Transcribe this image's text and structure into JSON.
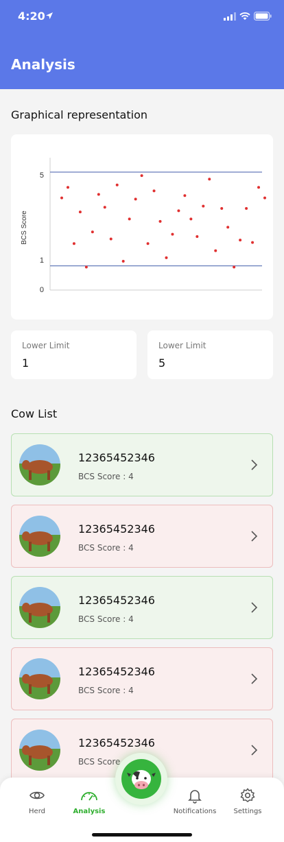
{
  "status_bar": {
    "time": "4:20"
  },
  "header": {
    "title": "Analysis"
  },
  "graph_section": {
    "title": "Graphical representation"
  },
  "chart_data": {
    "type": "scatter",
    "ylabel": "BCS Score",
    "xlabel": "",
    "y_ticks": [
      "5",
      "1",
      "0"
    ],
    "ylim": [
      0,
      5
    ],
    "reference_lines": [
      {
        "value": 5,
        "color": "#3f5aa8"
      },
      {
        "value": 1,
        "color": "#3f5aa8"
      }
    ],
    "grid": false,
    "point_color": "#e03030",
    "points": [
      {
        "x": 1,
        "y": 3.9
      },
      {
        "x": 2,
        "y": 4.35
      },
      {
        "x": 3,
        "y": 1.95
      },
      {
        "x": 4,
        "y": 3.3
      },
      {
        "x": 5,
        "y": 0.95
      },
      {
        "x": 6,
        "y": 2.45
      },
      {
        "x": 7,
        "y": 4.05
      },
      {
        "x": 8,
        "y": 3.5
      },
      {
        "x": 9,
        "y": 2.15
      },
      {
        "x": 10,
        "y": 4.45
      },
      {
        "x": 11,
        "y": 1.2
      },
      {
        "x": 12,
        "y": 3.0
      },
      {
        "x": 13,
        "y": 3.85
      },
      {
        "x": 14,
        "y": 4.85
      },
      {
        "x": 15,
        "y": 1.95
      },
      {
        "x": 16,
        "y": 4.2
      },
      {
        "x": 17,
        "y": 2.9
      },
      {
        "x": 18,
        "y": 1.35
      },
      {
        "x": 19,
        "y": 2.35
      },
      {
        "x": 20,
        "y": 3.35
      },
      {
        "x": 21,
        "y": 4.0
      },
      {
        "x": 22,
        "y": 3.0
      },
      {
        "x": 23,
        "y": 2.25
      },
      {
        "x": 24,
        "y": 3.55
      },
      {
        "x": 25,
        "y": 4.7
      },
      {
        "x": 26,
        "y": 1.65
      },
      {
        "x": 27,
        "y": 3.45
      },
      {
        "x": 28,
        "y": 2.65
      },
      {
        "x": 29,
        "y": 0.95
      },
      {
        "x": 30,
        "y": 2.1
      },
      {
        "x": 31,
        "y": 3.45
      },
      {
        "x": 32,
        "y": 2.0
      },
      {
        "x": 33,
        "y": 4.35
      },
      {
        "x": 34,
        "y": 3.9
      }
    ]
  },
  "limits": {
    "lower": {
      "label": "Lower Limit",
      "value": "1"
    },
    "upper": {
      "label": "Lower Limit",
      "value": "5"
    }
  },
  "cow_list": {
    "title": "Cow List",
    "items": [
      {
        "id": "12365452346",
        "score": "BCS Score : 4",
        "status": "good"
      },
      {
        "id": "12365452346",
        "score": "BCS Score : 4",
        "status": "bad"
      },
      {
        "id": "12365452346",
        "score": "BCS Score : 4",
        "status": "good"
      },
      {
        "id": "12365452346",
        "score": "BCS Score : 4",
        "status": "bad"
      },
      {
        "id": "12365452346",
        "score": "BCS Score : 4",
        "status": "bad"
      }
    ]
  },
  "tabbar": {
    "herd": "Herd",
    "analysis": "Analysis",
    "notifications": "Notifications",
    "settings": "Settings",
    "active_color": "#2eae2e",
    "icons": {
      "herd": "eye-icon",
      "analysis": "gauge-icon",
      "center": "cow-face-icon",
      "notifications": "bell-icon",
      "settings": "gear-icon"
    }
  },
  "colors": {
    "header": "#5b78e8",
    "accent": "#2eae2e",
    "good_card": "#eef6ec",
    "bad_card": "#faeeee"
  }
}
